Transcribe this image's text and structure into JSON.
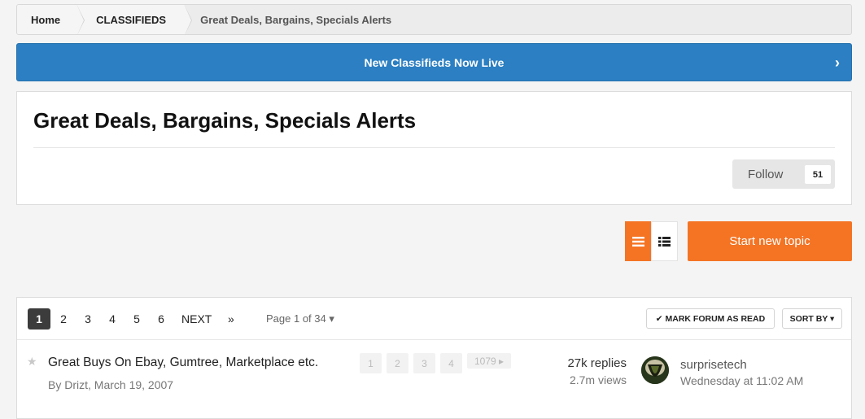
{
  "breadcrumb": {
    "home": "Home",
    "section": "CLASSIFIEDS",
    "current": "Great Deals, Bargains, Specials Alerts"
  },
  "banner": {
    "text": "New Classifieds Now Live",
    "chevron": "›",
    "color": "#2b7fc2"
  },
  "forum": {
    "title": "Great Deals, Bargains, Specials Alerts",
    "follow_label": "Follow",
    "follow_count": "51"
  },
  "actions": {
    "start_topic_label": "Start new topic",
    "accent_color": "#f47424",
    "view_icons": [
      "list-view-icon",
      "condensed-view-icon"
    ]
  },
  "pagination": {
    "pages": [
      "1",
      "2",
      "3",
      "4",
      "5",
      "6"
    ],
    "current": "1",
    "next_label": "NEXT",
    "last_label": "»",
    "page_of": "Page 1 of 34 ▾",
    "mark_read_label": "✔ MARK FORUM AS READ",
    "sort_label": "SORT BY ▾"
  },
  "topics": [
    {
      "title": "Great Buys On Ebay, Gumtree, Marketplace etc.",
      "meta": "By Drizt, March 19, 2007",
      "mini_pages": [
        "1",
        "2",
        "3",
        "4"
      ],
      "mini_last": "1079 ▸",
      "replies": "27k replies",
      "views": "2.7m views",
      "last_poster": "surprisetech",
      "last_date": "Wednesday at 11:02 AM"
    }
  ]
}
